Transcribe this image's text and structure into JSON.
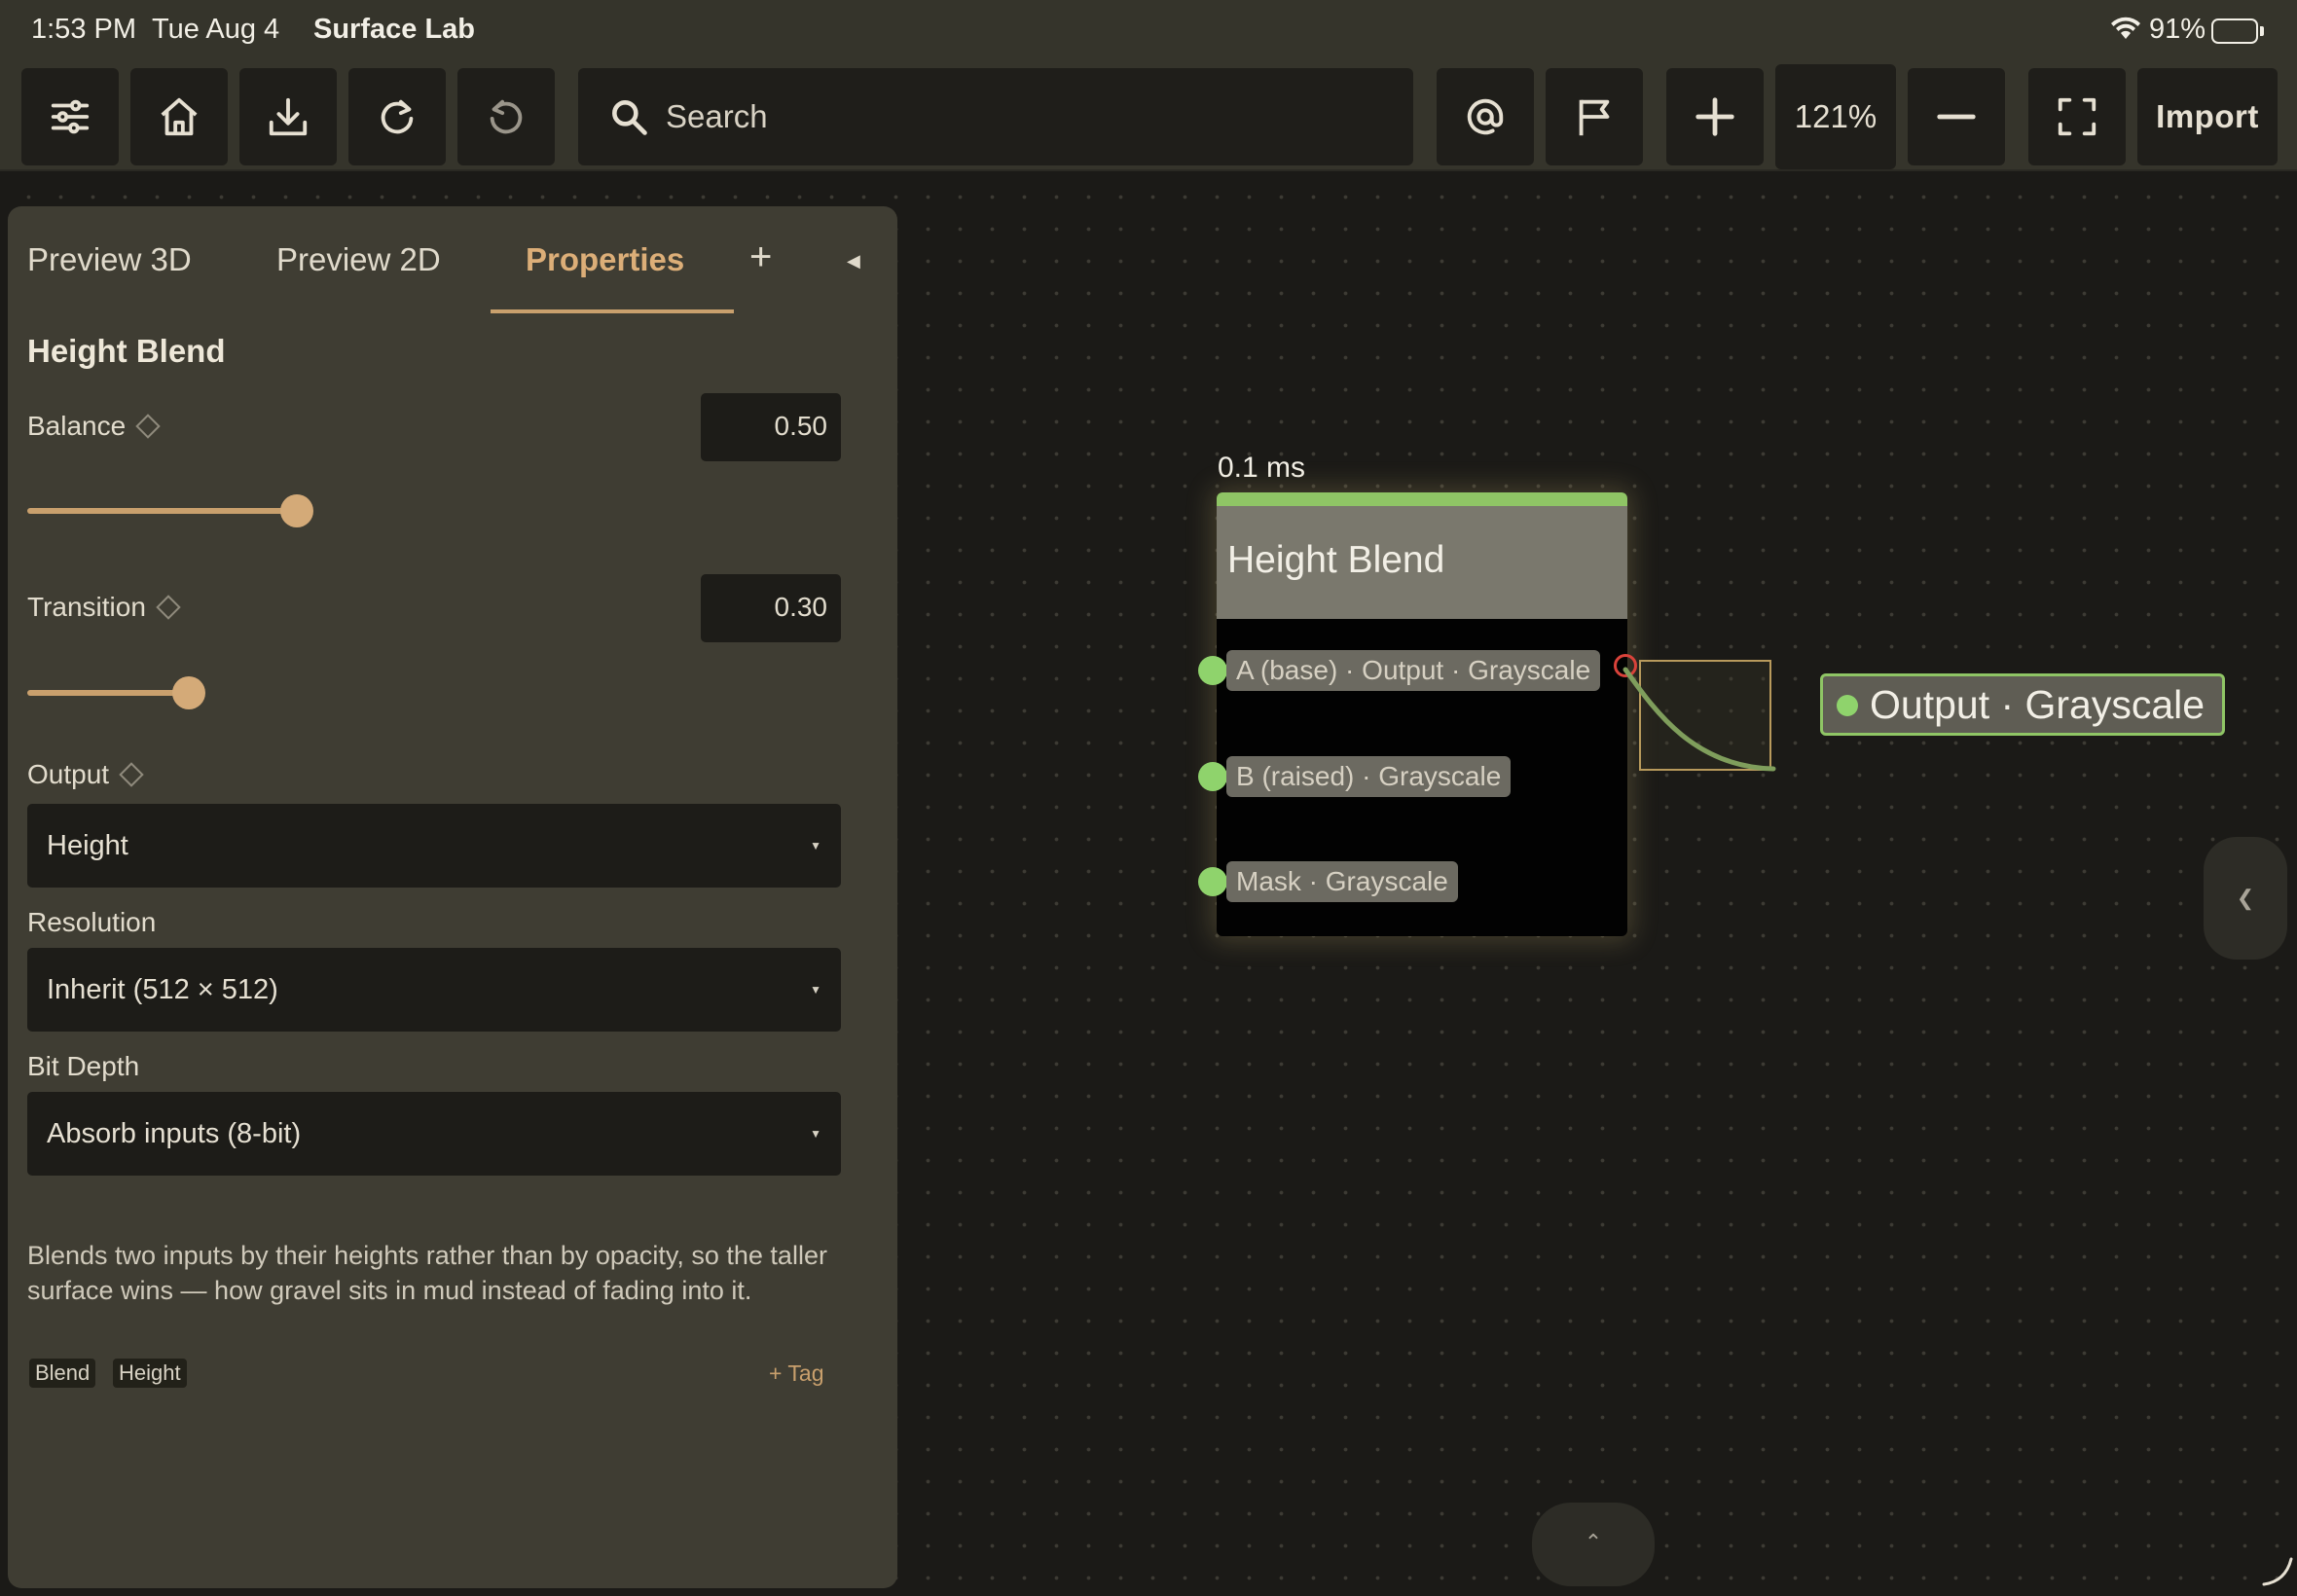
{
  "status_bar": {
    "time": "1:53 PM",
    "date": "Tue Aug 4",
    "app_name": "Surface Lab",
    "battery": "91%",
    "battery_level": 0.91
  },
  "toolbar": {
    "buttons": [
      "sliders-icon",
      "home-icon",
      "download-icon",
      "redo-icon",
      "undo-icon",
      "at-sign-icon",
      "flag-icon",
      "plus-icon",
      "minus-icon",
      "fullscreen-icon"
    ],
    "search_placeholder": "Search",
    "zoom": "121%",
    "import_label": "Import"
  },
  "panel": {
    "tabs": [
      {
        "label": "Preview 3D",
        "active": false
      },
      {
        "label": "Preview 2D",
        "active": false
      },
      {
        "label": "Properties",
        "active": true
      }
    ],
    "add_tab": "+",
    "node_title": "Height Blend",
    "balance": {
      "label": "Balance",
      "value": "0.50",
      "fraction": 0.5
    },
    "transition": {
      "label": "Transition",
      "value": "0.30",
      "fraction": 0.3
    },
    "output": {
      "label": "Output",
      "selected": "Height"
    },
    "resolution": {
      "label": "Resolution",
      "selected": "Inherit (512 × 512)"
    },
    "bit_depth": {
      "label": "Bit Depth",
      "selected": "Absorb inputs (8-bit)"
    },
    "description": "Blends two inputs by their heights rather than by opacity, so the taller surface wins — how gravel sits in mud instead of fading into it.",
    "tags": [
      "Blend",
      "Height"
    ],
    "add_tag": "+ Tag"
  },
  "graph": {
    "node": {
      "timing": "0.1 ms",
      "title": "Height Blend",
      "ports": [
        "A (base) · Output · Grayscale",
        "B (raised) · Grayscale",
        "Mask · Grayscale"
      ]
    },
    "output_node": "Output · Grayscale"
  },
  "colors": {
    "accent": "#c9a06d",
    "port_green": "#8fd36c",
    "error_red": "#d9423a"
  }
}
